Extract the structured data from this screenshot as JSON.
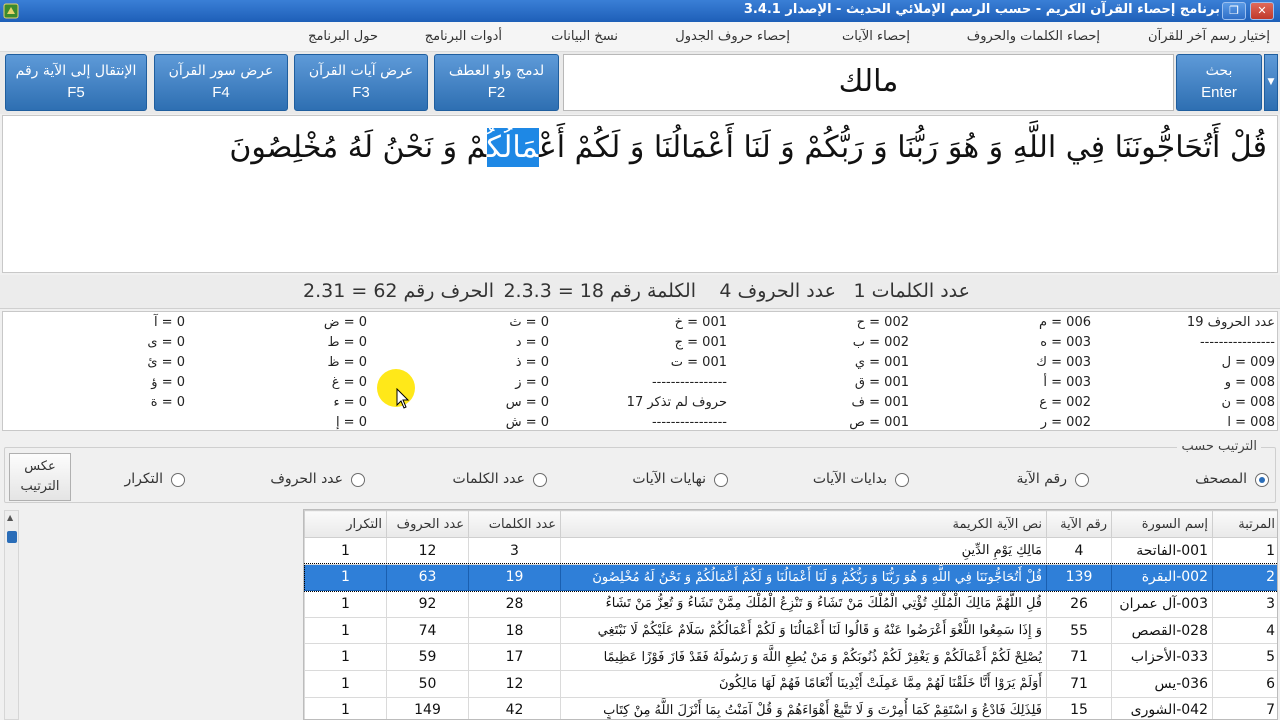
{
  "window": {
    "title": "برنامج إحصاء القرآن الكريم - حسب الرسم الإملائي الحديث - الإصدار 3.4.1",
    "restore_glyph": "❐",
    "close_glyph": "✕"
  },
  "menu": {
    "items": [
      "إختيار رسم آخر للقرآن",
      "إحصاء الكلمات والحروف",
      "إحصاء الآيات",
      "إحصاء حروف الجدول",
      "نسخ البيانات",
      "أدوات البرنامج",
      "حول البرنامج"
    ]
  },
  "toolbar": {
    "search_label": "بحث",
    "search_key": "Enter",
    "search_text": "مالك",
    "merge_label": "لدمج واو العطف",
    "merge_key": "F2",
    "verses_label": "عرض آيات القرآن",
    "verses_key": "F3",
    "suras_label": "عرض سور القرآن",
    "suras_key": "F4",
    "goto_label": "الإنتقال إلى الآية رقم",
    "goto_key": "F5",
    "dropdown_glyph": "▼"
  },
  "verse": {
    "before": "قُلْ أَتُحَاجُّونَنَا فِي اللَّهِ وَ هُوَ رَبُّنَا وَ رَبُّكُمْ وَ لَنَا أَعْمَالُنَا وَ لَكُمْ أَعْ",
    "highlight": "مَالُكُ",
    "after": "مْ وَ نَحْنُ لَهُ مُخْلِصُونَ"
  },
  "stats": {
    "words": "عدد الكلمات  1",
    "letters": "عدد الحروف  4",
    "word_no": "الكلمة رقم 18 = 2.3.3",
    "letter_no": "الحرف رقم 62 = 2.31"
  },
  "counts": {
    "col1": [
      "عدد الحروف 19",
      "----------------",
      "009 = ل",
      "008 = و",
      "008 = ن",
      "008 = ا"
    ],
    "col2": [
      "006 = م",
      "003 = ه",
      "003 = ك",
      "003 = أ",
      "002 = ع",
      "002 = ر"
    ],
    "col3": [
      "002 = ح",
      "002 = ب",
      "001 = ي",
      "001 = ق",
      "001 = ف",
      "001 = ص"
    ],
    "col4": [
      "001 = خ",
      "001 = ج",
      "001 = ت",
      "----------------",
      "حروف لم تذكر 17",
      "----------------"
    ],
    "col5": [
      "0 = ث",
      "0 = د",
      "0 = ذ",
      "0 = ز",
      "0 = س",
      "0 = ش"
    ],
    "col6": [
      "0 = ض",
      "0 = ط",
      "0 = ظ",
      "0 = غ",
      "0 = ء",
      "0 = إ"
    ],
    "col7": [
      "0 = آ",
      "0 = ى",
      "0 = ئ",
      "0 = ؤ",
      "0 = ة"
    ]
  },
  "sort": {
    "legend": "الترتيب حسب",
    "options": [
      "المصحف",
      "رقم الآية",
      "بدايات الآيات",
      "نهايات الآيات",
      "عدد الكلمات",
      "عدد الحروف",
      "التكرار"
    ],
    "selected": 0,
    "reverse_line1": "عكس",
    "reverse_line2": "الترتيب"
  },
  "table": {
    "headers": [
      "المرتبة",
      "إسم السورة",
      "رقم الآية",
      "نص الآية الكريمة",
      "عدد الكلمات",
      "عدد الحروف",
      "التكرار"
    ],
    "rows": [
      [
        "1",
        "001-الفاتحة",
        "4",
        "مَالِكِ يَوْمِ الدِّينِ",
        "3",
        "12",
        "1"
      ],
      [
        "2",
        "002-البقرة",
        "139",
        "قُلْ أَتُحَاجُّونَنَا فِي اللَّهِ وَ هُوَ رَبُّنَا وَ رَبُّكُمْ وَ لَنَا أَعْمَالُنَا وَ لَكُمْ أَعْمَالُكُمْ وَ نَحْنُ لَهُ مُخْلِصُونَ",
        "19",
        "63",
        "1"
      ],
      [
        "3",
        "003-آل عمران",
        "26",
        "قُلِ اللَّهُمَّ مَالِكَ الْمُلْكِ تُؤْتِي الْمُلْكَ مَنْ تَشَاءُ وَ تَنْزِعُ الْمُلْكَ مِمَّنْ تَشَاءُ وَ تُعِزُّ مَنْ تَشَاءُ",
        "28",
        "92",
        "1"
      ],
      [
        "4",
        "028-القصص",
        "55",
        "وَ إِذَا سَمِعُوا اللَّغْوَ أَعْرَضُوا عَنْهُ وَ قَالُوا لَنَا أَعْمَالُنَا وَ لَكُمْ أَعْمَالُكُمْ سَلَامٌ عَلَيْكُمْ لَا نَبْتَغِي",
        "18",
        "74",
        "1"
      ],
      [
        "5",
        "033-الأحزاب",
        "71",
        "يُصْلِحْ لَكُمْ أَعْمَالَكُمْ وَ يَغْفِرْ لَكُمْ ذُنُوبَكُمْ وَ مَنْ يُطِعِ اللَّهَ وَ رَسُولَهُ فَقَدْ فَازَ فَوْزًا عَظِيمًا",
        "17",
        "59",
        "1"
      ],
      [
        "6",
        "036-يس",
        "71",
        "أَوَلَمْ يَرَوْا أَنَّا خَلَقْنَا لَهُمْ مِمَّا عَمِلَتْ أَيْدِينَا أَنْعَامًا فَهُمْ لَهَا مَالِكُونَ",
        "12",
        "50",
        "1"
      ],
      [
        "7",
        "042-الشورى",
        "15",
        "فَلِذَلِكَ فَادْعُ وَ اسْتَقِمْ كَمَا أُمِرْتَ وَ لَا تَتَّبِعْ أَهْوَاءَهُمْ وَ قُلْ آمَنْتُ بِمَا أَنْزَلَ اللَّهُ مِنْ كِتَابٍ",
        "42",
        "149",
        "1"
      ]
    ],
    "selected_row": 1
  },
  "colors": {
    "accent": "#2e6fb2",
    "selection": "#2f7fd8",
    "highlight": "#1e88e5",
    "cursor_ring": "#ffe600"
  }
}
